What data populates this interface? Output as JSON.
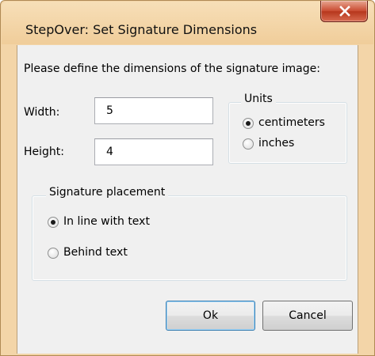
{
  "window": {
    "title": "StepOver: Set Signature Dimensions",
    "close_icon": "close-x-icon"
  },
  "dialog": {
    "instruction": "Please define the dimensions of the signature image:",
    "width_label": "Width:",
    "width_value": "5",
    "height_label": "Height:",
    "height_value": "4",
    "units": {
      "legend": "Units",
      "options": [
        "centimeters",
        "inches"
      ],
      "selected": "centimeters"
    },
    "placement": {
      "legend": "Signature placement",
      "options": [
        "In line with text",
        "Behind text"
      ],
      "selected": "In line with text"
    },
    "ok_label": "Ok",
    "cancel_label": "Cancel"
  },
  "colors": {
    "frame": "#f3d5a8",
    "client": "#f0f0f0",
    "close_button": "#c94a30"
  }
}
